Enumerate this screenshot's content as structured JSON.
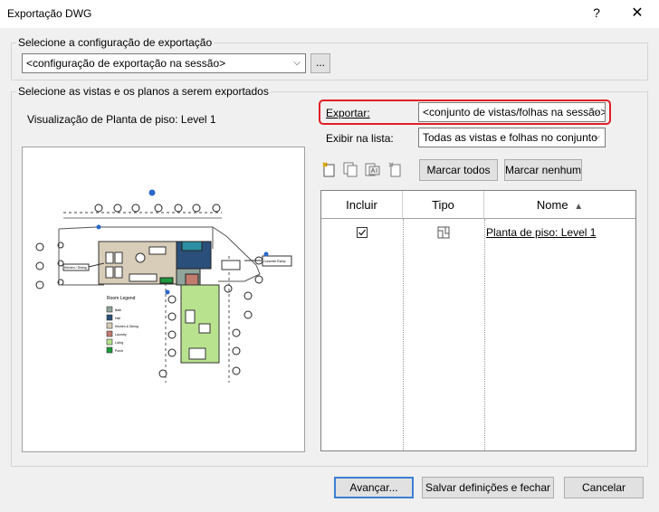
{
  "window": {
    "title": "Exportação DWG",
    "help_glyph": "?",
    "close_glyph": "✕"
  },
  "config_group": {
    "label": "Selecione a configuração de exportação",
    "value": "<configuração de exportação na sessão>",
    "browse_label": "..."
  },
  "views_group": {
    "label": "Selecione as vistas e os planos a serem exportados",
    "preview_label": "Visualização de Planta de piso: Level 1",
    "export_label": "Exportar:",
    "export_value": "<conjunto de vistas/folhas na sessão>",
    "show_label": "Exibir na lista:",
    "show_value": "Todas as vistas e folhas no conjunto",
    "mark_all": "Marcar todos",
    "mark_none": "Marcar nenhum",
    "preview": {
      "room_legend_title": "Room Legend",
      "legend": [
        {
          "name": "Bath",
          "color": "#8fa49a"
        },
        {
          "name": "Hall",
          "color": "#2a4f7a"
        },
        {
          "name": "Kitchen & Dining",
          "color": "#d8cdb8"
        },
        {
          "name": "Laundry",
          "color": "#c27b6f"
        },
        {
          "name": "Living",
          "color": "#b9e28f"
        },
        {
          "name": "Porch",
          "color": "#1f9a3c"
        }
      ],
      "tag_left": "Kitchen / Dining",
      "tag_right": "Concrete Ramp"
    }
  },
  "table": {
    "columns": [
      "Incluir",
      "Tipo",
      "Nome"
    ],
    "sort_glyph": "▲",
    "rows": [
      {
        "included": true,
        "name": "Planta de piso: Level 1"
      }
    ]
  },
  "footer": {
    "next": "Avançar...",
    "save_close": "Salvar definições e fechar",
    "cancel": "Cancelar"
  }
}
